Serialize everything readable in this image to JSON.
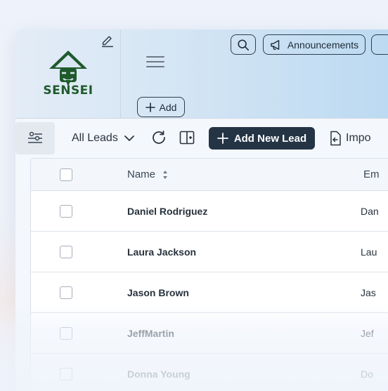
{
  "brand": {
    "name": "SENSEI",
    "primary_color": "#1f5a2c"
  },
  "header": {
    "search_icon": "search-icon",
    "announcements_label": "Announcements",
    "add_label": "Add"
  },
  "toolbar": {
    "view_selected": "All Leads",
    "add_new_lead_label": "Add New Lead",
    "import_label": "Impo",
    "accent_color": "#243445"
  },
  "table": {
    "columns": [
      "Name",
      "Em"
    ],
    "rows": [
      {
        "name": "Daniel Rodriguez",
        "email": "Dan"
      },
      {
        "name": "Laura Jackson",
        "email": "Lau"
      },
      {
        "name": "Jason Brown",
        "email": "Jas"
      },
      {
        "name": "JeffMartin",
        "email": "Jef"
      },
      {
        "name": "Donna Young",
        "email": "Do"
      }
    ]
  }
}
